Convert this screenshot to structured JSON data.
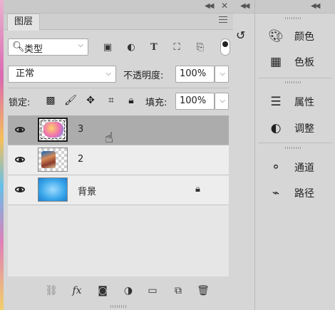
{
  "layers_panel": {
    "tab_label": "图层",
    "filter": {
      "kind_label": "类型"
    },
    "blend_mode": "正常",
    "opacity_label": "不透明度:",
    "opacity_value": "100%",
    "lock_label": "锁定:",
    "fill_label": "填充:",
    "fill_value": "100%",
    "layers": [
      {
        "name": "3",
        "selected": true
      },
      {
        "name": "2",
        "selected": false
      },
      {
        "name": "背景",
        "selected": false,
        "locked": true
      }
    ]
  },
  "right_dock": {
    "items": [
      {
        "label": "颜色",
        "icon": "palette-icon"
      },
      {
        "label": "色板",
        "icon": "swatches-grid-icon"
      },
      {
        "label": "属性",
        "icon": "properties-icon"
      },
      {
        "label": "调整",
        "icon": "adjustments-icon"
      },
      {
        "label": "通道",
        "icon": "channels-icon"
      },
      {
        "label": "路径",
        "icon": "paths-pen-icon"
      }
    ]
  },
  "colors": {
    "panel_bg": "#d6d6d6",
    "selected_layer_bg": "#acacac",
    "layer_bg": "#ededed"
  }
}
